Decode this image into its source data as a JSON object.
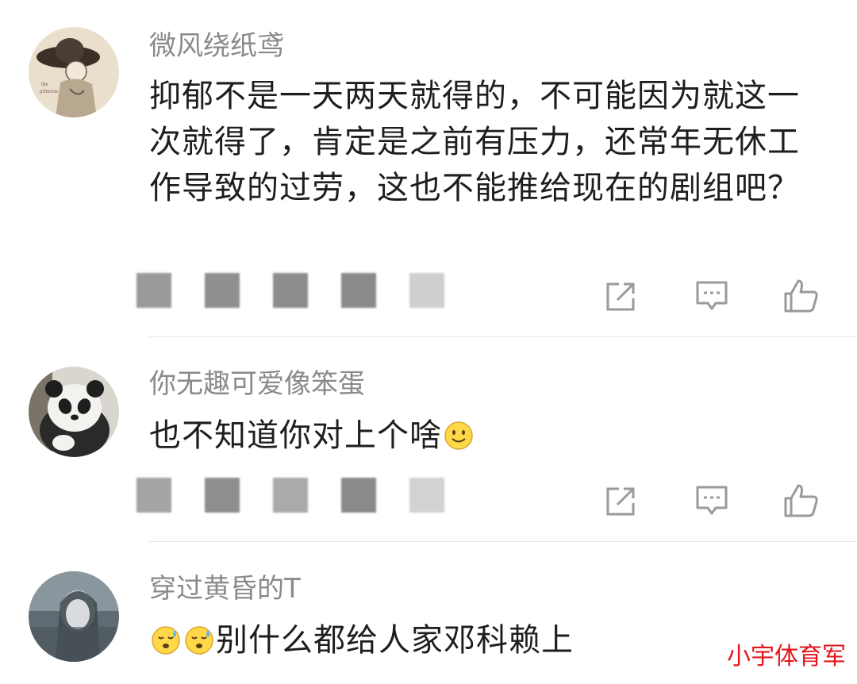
{
  "comments": [
    {
      "username": "微风绕纸鸢",
      "text": "抑郁不是一天两天就得的，不可能因为就这一次就得了，肯定是之前有压力，还常年无休工作导致的过劳，这也不能推给现在的剧组吧？",
      "avatar_icon": "vintage-lady-hat-avatar"
    },
    {
      "username": "你无趣可爱像笨蛋",
      "text": "也不知道你对上个啥",
      "trailing_emoji": "smile-emoji",
      "avatar_icon": "panda-avatar"
    },
    {
      "username": "穿过黄昏的T",
      "text": "别什么都给人家邓科赖上",
      "leading_emojis": [
        "sweat-emoji",
        "sweat-emoji"
      ],
      "avatar_icon": "misty-portrait-avatar"
    }
  ],
  "actions": {
    "icons": [
      "share-icon",
      "reply-icon",
      "like-icon"
    ]
  },
  "watermark": "小宇体育军",
  "colors": {
    "username": "#8a8a8a",
    "text": "#1e1e1e",
    "icon": "#9a9a9a",
    "watermark": "#e2161c",
    "divider": "#e6e6e6"
  }
}
